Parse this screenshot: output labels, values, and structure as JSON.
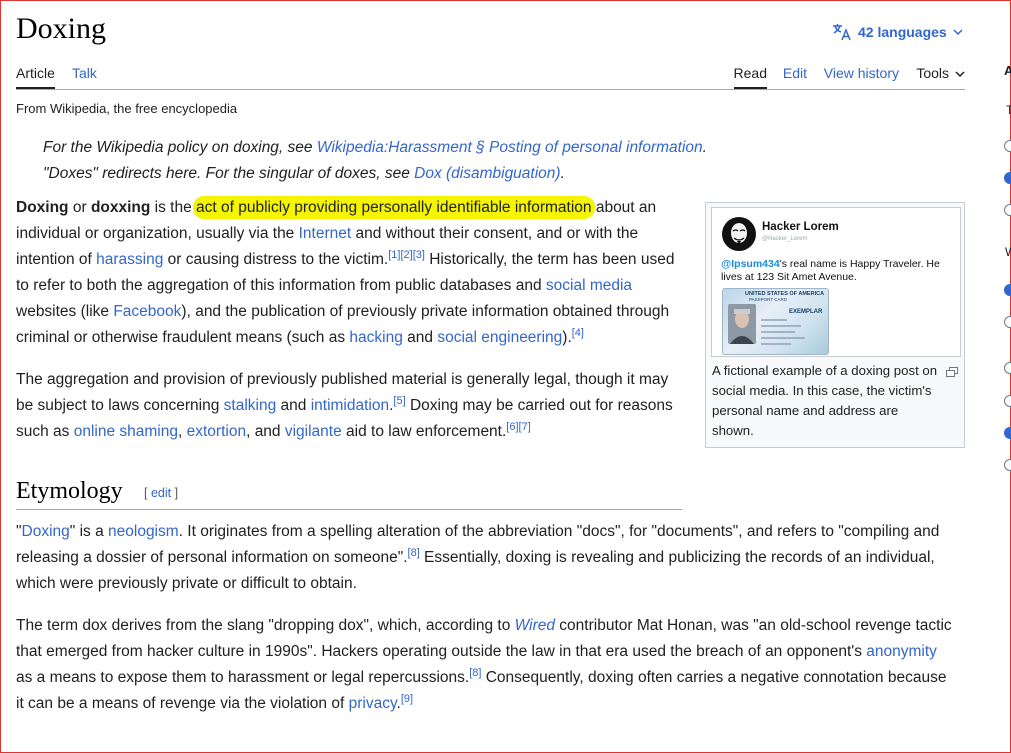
{
  "page": {
    "title": "Doxing",
    "from": "From Wikipedia, the free encyclopedia"
  },
  "languages": {
    "label": "42 languages"
  },
  "tabs": {
    "article": "Article",
    "talk": "Talk",
    "read": "Read",
    "edit": "Edit",
    "history": "View history",
    "tools": "Tools"
  },
  "hatnotes": [
    {
      "pre": "For the Wikipedia policy on doxing, see ",
      "link": "Wikipedia:Harassment § Posting of personal information",
      "post": "."
    },
    {
      "pre": "\"Doxes\" redirects here. For the singular of doxes, see ",
      "link": "Dox (disambiguation)",
      "post": "."
    }
  ],
  "lead": {
    "p1": {
      "b1": "Doxing",
      "t1": " or ",
      "b2": "doxxing",
      "t2": " is the ",
      "highlight": "act of publicly providing personally identifiable information",
      "t3": " about an individual or organization, usually via the ",
      "l_internet": "Internet",
      "t4": " and without their consent, and or with the intention of ",
      "l_harassing": "harassing",
      "t5": " or causing distress to the victim.",
      "ref1": "[1]",
      "ref2": "[2]",
      "ref3": "[3]",
      "t6": " Historically, the term has been used to refer to both the aggregation of this information from public databases and ",
      "l_social": "social media",
      "t7": " websites (like ",
      "l_facebook": "Facebook",
      "t8": "), and the publication of previously private information obtained through criminal or otherwise fraudulent means (such as ",
      "l_hacking": "hacking",
      "t9": " and ",
      "l_soceng": "social engineering",
      "t10": ").",
      "ref4": "[4]"
    },
    "p2": {
      "t1": "The aggregation and provision of previously published material is generally legal, though it may be subject to laws concerning ",
      "l_stalking": "stalking",
      "t2": " and ",
      "l_intimidation": "intimidation",
      "t3": ".",
      "ref5": "[5]",
      "t4": " Doxing may be carried out for reasons such as ",
      "l_shaming": "online shaming",
      "t5": ", ",
      "l_extortion": "extortion",
      "t6": ", and ",
      "l_vigilante": "vigilante",
      "t7": " aid to law enforcement.",
      "ref6": "[6]",
      "ref7": "[7]"
    }
  },
  "infobox": {
    "tweet": {
      "name": "Hacker Lorem",
      "handle": "@Hacker_Lorem",
      "mention": "@Ipsum434",
      "text": "'s real name is Happy Traveler. He lives at 123 Sit Amet Avenue."
    },
    "card": {
      "header": "UNITED STATES OF AMERICA",
      "sub": "PASSPORT CARD",
      "watermark": "EXEMPLAR"
    },
    "caption": "A fictional example of a doxing post on social media. In this case, the victim's personal name and address are shown."
  },
  "etymology": {
    "heading": "Etymology",
    "edit_open": "[ ",
    "edit_label": "edit",
    "edit_close": " ]",
    "p1": {
      "q1": "\"",
      "l_doxing": "Doxing",
      "t1": "\" is a ",
      "l_neologism": "neologism",
      "t2": ". It originates from a spelling alteration of the abbreviation \"docs\", for \"documents\", and refers to \"compiling and releasing a dossier of personal information on someone\".",
      "ref8": "[8]",
      "t3": " Essentially, doxing is revealing and publicizing the records of an individual, which were previously private or difficult to obtain."
    },
    "p2": {
      "t1": "The term dox derives from the slang \"dropping dox\", which, according to ",
      "l_wired": "Wired",
      "t2": " contributor Mat Honan, was \"an old-school revenge tactic that emerged from hacker culture in 1990s\". Hackers operating outside the law in that era used the breach of an opponent's ",
      "l_anonymity": "anonymity",
      "t3": " as a means to expose them to harassment or legal repercussions.",
      "ref8": "[8]",
      "t4": " Consequently, doxing often carries a negative connotation because it can be a means of revenge via the violation of ",
      "l_privacy": "privacy",
      "t5": ".",
      "ref9": "[9]"
    }
  },
  "sidebar": {
    "letter_a": "A",
    "letter_t": "T",
    "letter_w": "W"
  },
  "colors": {
    "link": "#3366cc",
    "highlight": "#f5f500",
    "frame": "#dd3333"
  }
}
